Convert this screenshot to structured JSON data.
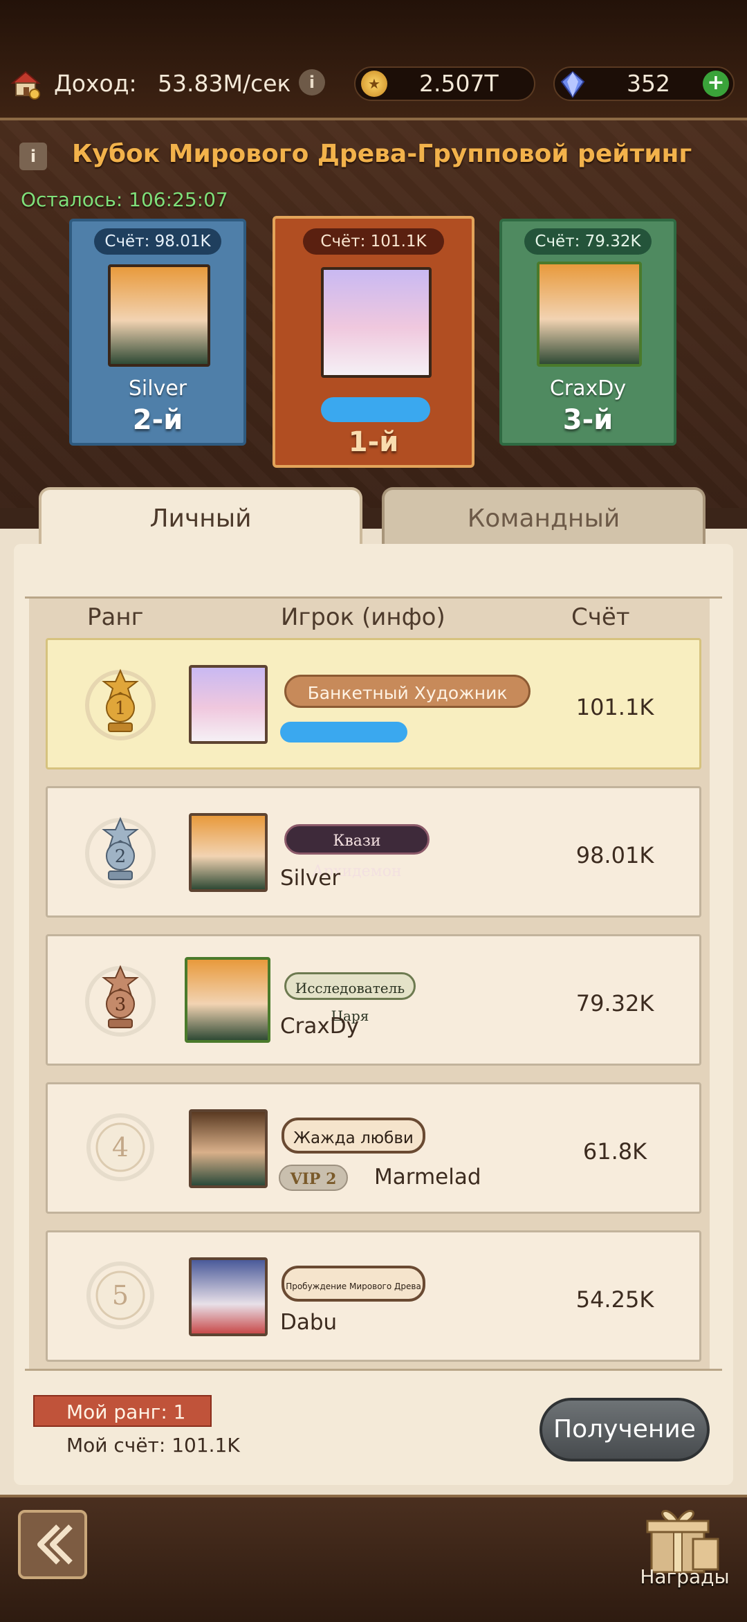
{
  "topbar": {
    "income_label": "Доход:",
    "income_value": "53.83M/сек",
    "gold_value": "2.507T",
    "gems_value": "352",
    "icons": [
      "house-icon",
      "info-icon",
      "gold-coin-icon",
      "crystal-icon",
      "plus-icon"
    ]
  },
  "header": {
    "title": "Кубок Мирового Древа-Групповой рейтинг",
    "timer": "Осталось: 106:25:07"
  },
  "podium": [
    {
      "score_text": "Счёт: 98.01K",
      "name": "Silver",
      "rank": "2-й",
      "color": "#4f7fa9"
    },
    {
      "score_text": "Счёт: 101.1K",
      "name": "",
      "rank": "1-й",
      "color": "#b14e22"
    },
    {
      "score_text": "Счёт: 79.32K",
      "name": "CraxDy",
      "rank": "3-й",
      "color": "#4f8a60"
    }
  ],
  "tabs": {
    "personal": "Личный",
    "team": "Командный"
  },
  "table": {
    "col_rank": "Ранг",
    "col_player": "Игрок (инфо)",
    "col_score": "Счёт",
    "rows": [
      {
        "rank": "1",
        "title_badge": "Банкетный Художник",
        "vip": "",
        "name": "",
        "score": "101.1K"
      },
      {
        "rank": "2",
        "title_badge": "Квази Архидемон",
        "vip": "",
        "name": "Silver",
        "score": "98.01K"
      },
      {
        "rank": "3",
        "title_badge": "Исследователь Царя",
        "vip": "",
        "name": "CraxDy",
        "score": "79.32K"
      },
      {
        "rank": "4",
        "title_badge": "Жажда любви",
        "vip": "VIP 2",
        "name": "Marmelad",
        "score": "61.8K"
      },
      {
        "rank": "5",
        "title_badge": "Пробуждение Мирового Древа",
        "vip": "",
        "name": "Dabu",
        "score": "54.25K"
      }
    ]
  },
  "my_rank": "Мой ранг: 1",
  "my_score": "Мой счёт: 101.1K",
  "claim_button": "Получение",
  "rewards_label": "Награды",
  "colors": {
    "accent_orange": "#f2b24b",
    "timer_green": "#7fe07a",
    "gold_medal": "#e0a63a",
    "silver_medal": "#9fb3c5",
    "bronze_medal": "#c48a6a"
  }
}
